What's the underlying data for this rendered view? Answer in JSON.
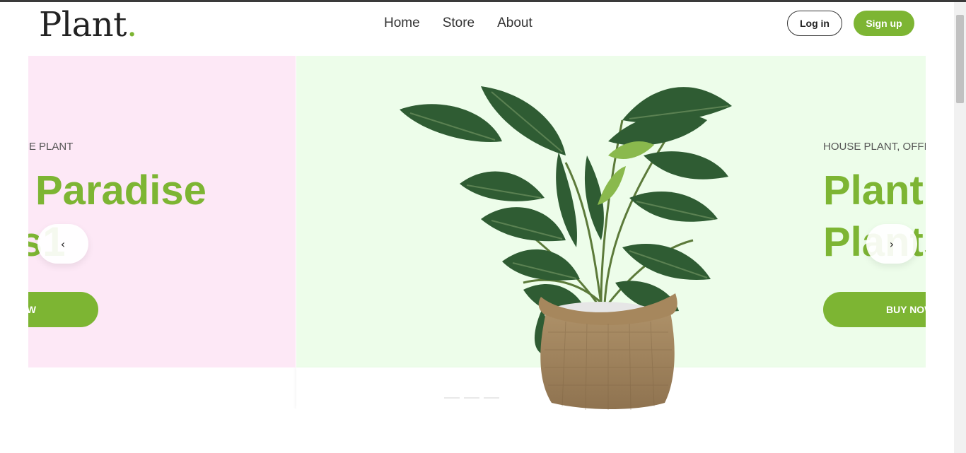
{
  "header": {
    "logo_text": "Plant",
    "logo_dot": ".",
    "nav": [
      {
        "label": "Home"
      },
      {
        "label": "Store"
      },
      {
        "label": "About"
      }
    ],
    "login_label": "Log in",
    "signup_label": "Sign up"
  },
  "slides": {
    "left": {
      "eyebrow": "CE PLANT",
      "title_line1": "Paradise",
      "title_line2": "s1",
      "button_label": "W"
    },
    "right": {
      "eyebrow": "HOUSE PLANT, OFFIC",
      "title_line1": "Plant",
      "title_line2": "Plants",
      "button_label": "BUY NOW"
    }
  },
  "controls": {
    "prev_icon": "chevron-left-icon",
    "next_icon": "chevron-right-icon",
    "prev_glyph": "‹",
    "next_glyph": "›"
  },
  "colors": {
    "accent": "#7db533",
    "left_slide_bg": "#fde8f6",
    "center_slide_bg": "#edfdea"
  }
}
